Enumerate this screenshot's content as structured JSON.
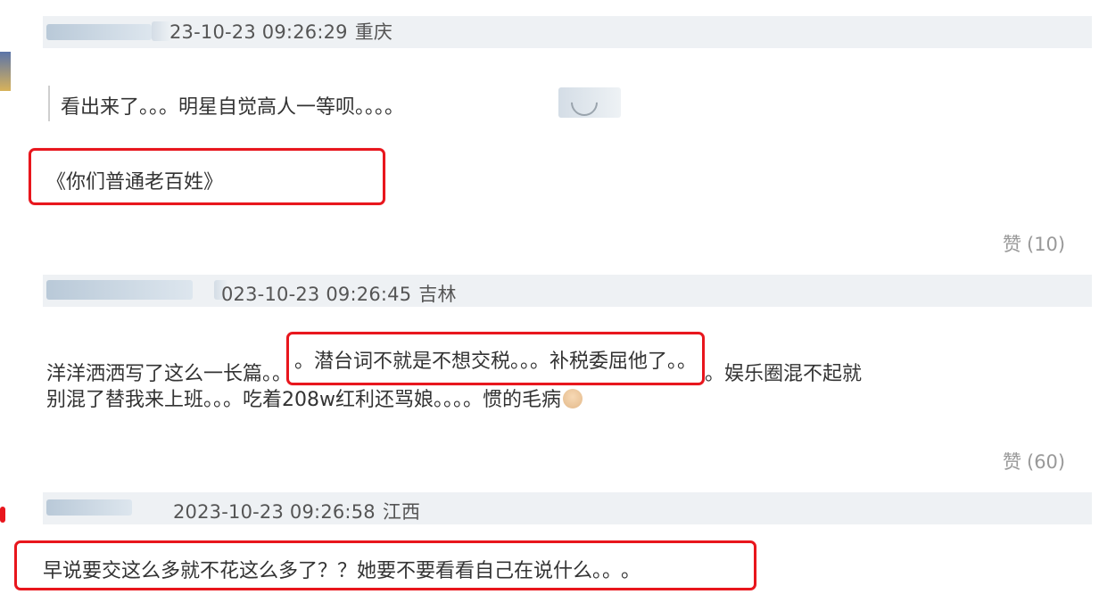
{
  "comments": [
    {
      "time": "2023-10-23 09:26:29",
      "time_visible": "23-10-23 09:26:29",
      "location": "重庆",
      "quote": "看出来了。。。明星自觉高人一等呗。。。。",
      "body": "《你们普通老百姓》",
      "like_label": "赞",
      "like_count": "(10)"
    },
    {
      "time": "2023-10-23 09:26:45",
      "time_visible": "023-10-23 09:26:45",
      "location": "吉林",
      "body_line1_pre": "洋洋洒洒写了这么一长篇。。",
      "body_line1_highlight": "。潜台词不就是不想交税。。。补税委屈他了。。",
      "body_line1_post": "。娱乐圈混不起就",
      "body_line2": "别混了替我来上班。。。吃着208w红利还骂娘。。。。惯的毛病",
      "like_label": "赞",
      "like_count": "(60)"
    },
    {
      "time": "2023-10-23 09:26:58",
      "location": "江西",
      "body_highlight": "早说要交这么多就不花这么多了？？她要不要看看自己在说什么。。",
      "body_post": "。"
    }
  ],
  "colors": {
    "highlight_border": "#e8161d",
    "header_bg": "#eef1f4",
    "text": "#333333",
    "meta_text": "#555555",
    "like_text": "#999999"
  }
}
